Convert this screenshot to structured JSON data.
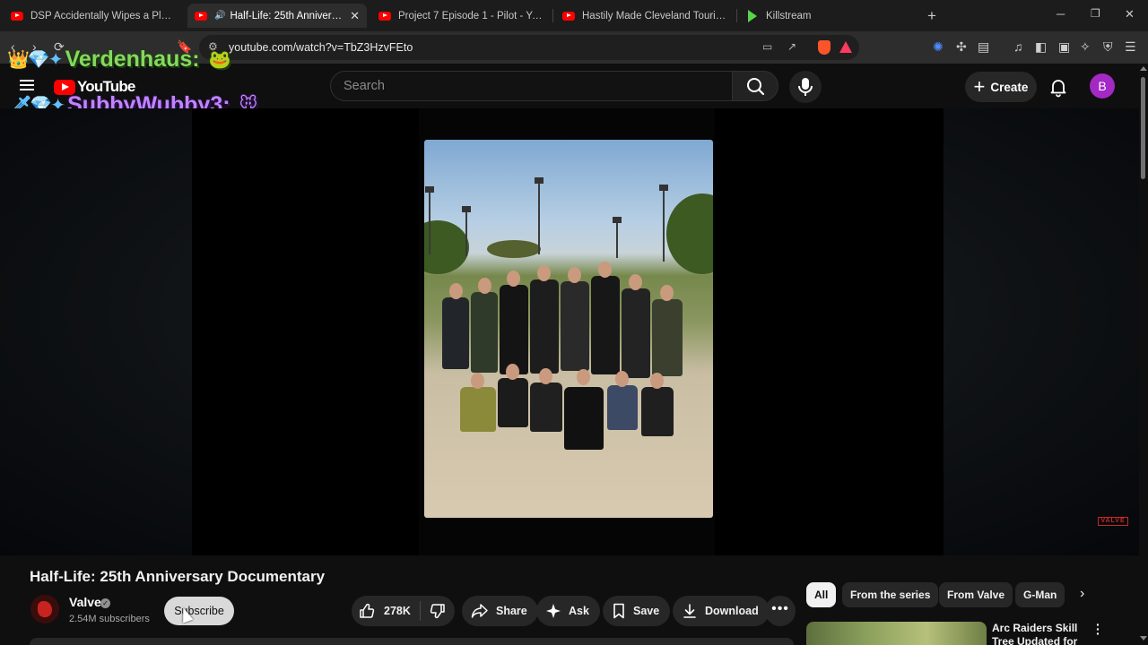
{
  "browser": {
    "tabs": [
      {
        "title": "DSP Accidentally Wipes a Player... an",
        "favicon": "youtube-icon",
        "active": false
      },
      {
        "title": "Half-Life: 25th Anniversary Do",
        "favicon": "youtube-icon",
        "active": true,
        "audio": true
      },
      {
        "title": "Project 7 Episode 1 - Pilot - YouTube",
        "favicon": "youtube-icon",
        "active": false
      },
      {
        "title": "Hastily Made Cleveland Tourism Vide",
        "favicon": "youtube-icon",
        "active": false
      },
      {
        "title": "Killstream",
        "favicon": "rumble-icon",
        "active": false
      }
    ],
    "address": "youtube.com/watch?v=TbZ3HzvFEto"
  },
  "youtube": {
    "logo_text": "YouTube",
    "search_placeholder": "Search",
    "create_label": "Create",
    "avatar_letter": "B",
    "avatar_color": "#a328c4"
  },
  "chat_overlay": [
    {
      "user": "Verdenhaus:",
      "color": "#85d85f"
    },
    {
      "user": "SubbyWubby3:",
      "color": "#c084ff"
    }
  ],
  "video": {
    "title": "Half-Life: 25th Anniversary Documentary",
    "watermark": "VALVE",
    "channel": {
      "name": "Valve",
      "subscribers": "2.54M subscribers",
      "verified": true
    },
    "subscribe_label": "Subscribe",
    "actions": {
      "likes": "278K",
      "share": "Share",
      "ask": "Ask",
      "save": "Save",
      "download": "Download"
    }
  },
  "sidebar": {
    "chips": [
      "All",
      "From the series",
      "From Valve",
      "G-Man"
    ],
    "active_chip": "All",
    "recommendation": {
      "title": "Arc Raiders Skill Tree Updated for"
    }
  }
}
